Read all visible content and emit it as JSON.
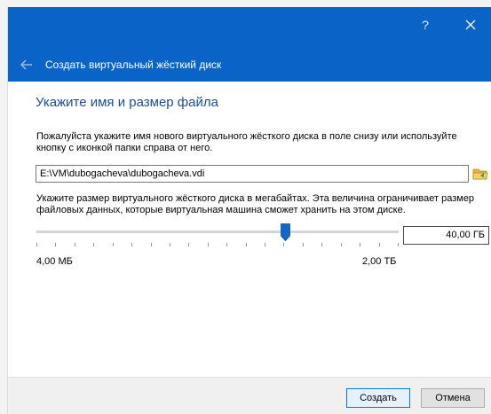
{
  "window": {
    "help_label": "?",
    "title": "Создать виртуальный жёсткий диск"
  },
  "page": {
    "heading": "Укажите имя и размер файла",
    "location_description": "Пожалуйста укажите имя нового виртуального жёсткого диска в поле снизу или используйте кнопку с иконкой папки справа от него.",
    "size_description": "Укажите размер виртуального жёсткого диска в мегабайтах. Эта величина ограничивает размер файловых данных, которые виртуальная машина сможет хранить на этом диске."
  },
  "path_field": {
    "value": "E:\\VM\\dubogacheva\\dubogacheva.vdi"
  },
  "size": {
    "value": "40,00 ГБ",
    "min_label": "4,00 МБ",
    "max_label": "2,00 ТБ",
    "slider_fraction": 0.688
  },
  "buttons": {
    "create": "Создать",
    "cancel": "Отмена"
  },
  "colors": {
    "accent": "#0a64c8",
    "heading": "#1e4c98",
    "slider_handle": "#1167c6"
  },
  "icons": {
    "back": "back-arrow-icon",
    "close": "close-icon",
    "folder": "folder-icon"
  }
}
